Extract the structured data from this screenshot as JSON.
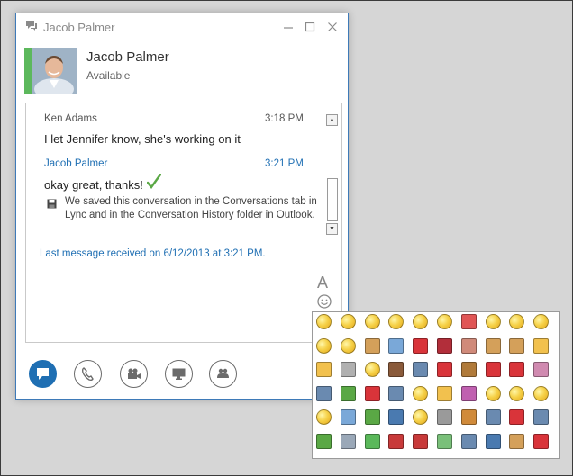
{
  "window": {
    "title": "Jacob Palmer",
    "minimize_icon": "minimize-icon",
    "maximize_icon": "maximize-icon",
    "close_icon": "close-icon"
  },
  "contact": {
    "name": "Jacob Palmer",
    "status": "Available",
    "presence_color": "#5cb85c"
  },
  "conversation": {
    "messages": [
      {
        "sender": "Ken Adams",
        "time": "3:18 PM",
        "text": "I let Jennifer know, she's working on it"
      },
      {
        "sender": "Jacob Palmer",
        "time": "3:21 PM",
        "text": "okay great, thanks!"
      }
    ],
    "notice": "We saved this conversation in the Conversations tab in Lync and in the Conversation History folder in Outlook.",
    "last_message": "Last message received on 6/12/2013 at 3:21 PM."
  },
  "compose": {
    "font_button": "A",
    "emoticon_icon": "smiley-icon"
  },
  "actions": [
    {
      "name": "im-button",
      "icon": "chat-bubble-icon",
      "active": true
    },
    {
      "name": "call-button",
      "icon": "phone-icon",
      "active": false
    },
    {
      "name": "video-button",
      "icon": "video-camera-icon",
      "active": false
    },
    {
      "name": "present-button",
      "icon": "monitor-icon",
      "active": false
    },
    {
      "name": "participants-button",
      "icon": "people-icon",
      "active": false
    }
  ],
  "colors": {
    "accent": "#1f6fb3",
    "presence_available": "#5cb85c",
    "check": "#5aa845"
  }
}
